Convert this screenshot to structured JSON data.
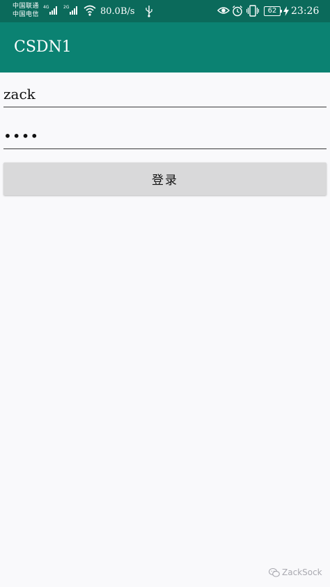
{
  "status_bar": {
    "carrier_1": "中国联通",
    "carrier_2": "中国电信",
    "sim1_network": "4G",
    "sim2_network": "2G",
    "net_speed": "80.0B/s",
    "battery_level": "62",
    "time": "23:26",
    "icons": [
      "signal-icon",
      "signal-icon",
      "wifi-icon",
      "usb-icon",
      "eye-icon",
      "alarm-icon",
      "vibrate-icon",
      "battery-icon",
      "charging-icon"
    ]
  },
  "app_bar": {
    "title": "CSDN1",
    "color": "#0b8272"
  },
  "form": {
    "username_value": "zack",
    "password_value": "••••",
    "login_label": "登录"
  },
  "watermark": {
    "icon": "wechat-icon",
    "text": "ZackSock"
  },
  "colors": {
    "status_bar": "#0b6a5b",
    "app_bar": "#0b8272",
    "background": "#f9f9fb",
    "button": "#d9d9da"
  }
}
